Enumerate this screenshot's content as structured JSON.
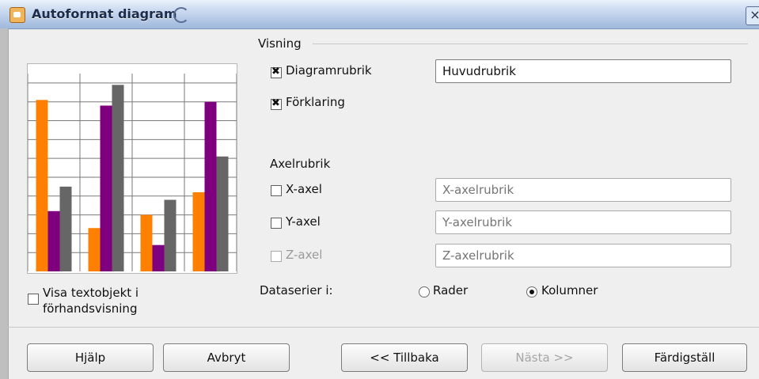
{
  "window": {
    "title": "Autoformat diagram",
    "close_label": "×"
  },
  "display_section": {
    "heading": "Visning",
    "chart_title_checkbox": {
      "label": "Diagramrubrik",
      "checked": true
    },
    "chart_title_input": {
      "value": "Huvudrubrik"
    },
    "legend_checkbox": {
      "label": "Förklaring",
      "checked": true
    }
  },
  "axis_section": {
    "heading": "Axelrubrik",
    "x_axis": {
      "label": "X-axel",
      "checked": false,
      "placeholder": "X-axelrubrik"
    },
    "y_axis": {
      "label": "Y-axel",
      "checked": false,
      "placeholder": "Y-axelrubrik"
    },
    "z_axis": {
      "label": "Z-axel",
      "checked": false,
      "disabled": true,
      "placeholder": "Z-axelrubrik"
    }
  },
  "data_series": {
    "label": "Dataserier i:",
    "rows_option": {
      "label": "Rader",
      "selected": false
    },
    "columns_option": {
      "label": "Kolumner",
      "selected": true
    }
  },
  "preview_option": {
    "label": "Visa textobjekt i förhandsvisning",
    "checked": false
  },
  "buttons": {
    "help": "Hjälp",
    "cancel": "Avbryt",
    "back": "<< Tillbaka",
    "next": "Nästa >>",
    "finish": "Färdigställ"
  },
  "chart_data": {
    "type": "bar",
    "title": "",
    "categories": [
      "",
      "",
      "",
      ""
    ],
    "series": [
      {
        "values": [
          9.1,
          2.3,
          3.0,
          4.2
        ],
        "color": "#ff7f00"
      },
      {
        "values": [
          3.2,
          8.8,
          1.4,
          9.0
        ],
        "color": "#7f007f"
      },
      {
        "values": [
          4.5,
          9.9,
          3.8,
          6.1
        ],
        "color": "#666666"
      }
    ],
    "ylim": [
      0,
      10.5
    ],
    "grid": true,
    "legend": "none"
  },
  "colors": {
    "orange": "#ff7f00",
    "purple": "#7f007f",
    "gray": "#666666"
  }
}
